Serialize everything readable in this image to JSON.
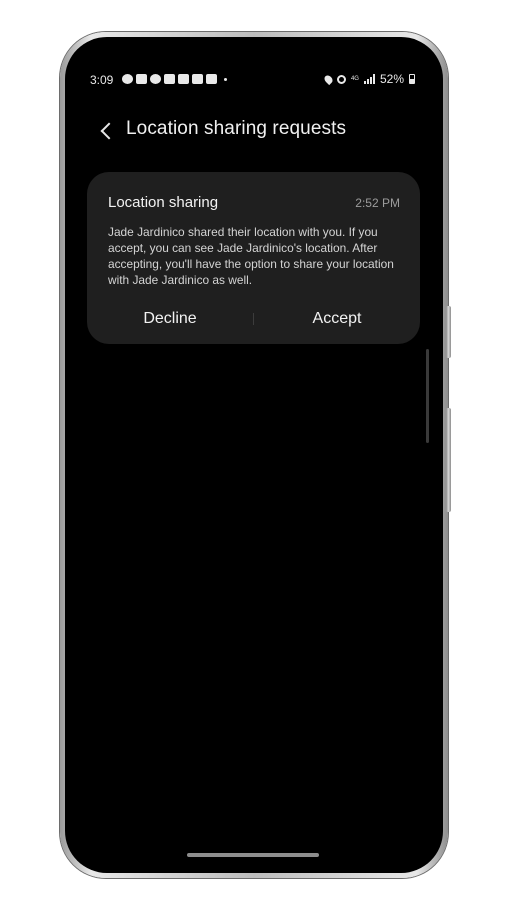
{
  "status_bar": {
    "time": "3:09",
    "battery": "52%",
    "network": "4G",
    "icons_left": [
      "minus-circle-icon",
      "screenshot-icon",
      "headset-icon",
      "gallery-icon",
      "image-icon",
      "youtube-icon",
      "youtube-icon",
      "dot-icon"
    ],
    "icons_right": [
      "location-icon",
      "hotspot-icon",
      "lte-icon",
      "signal-icon",
      "battery-icon"
    ]
  },
  "header": {
    "title": "Location sharing requests",
    "back_icon": "chevron-left-icon"
  },
  "notification": {
    "title": "Location sharing",
    "time": "2:52 PM",
    "body": "Jade Jardinico shared their location with you. If you accept, you can see Jade Jardinico's location. After accepting, you'll have the option to share your location with Jade Jardinico as well.",
    "decline_label": "Decline",
    "accept_label": "Accept"
  },
  "colors": {
    "background": "#000000",
    "card": "#1f1f1f",
    "text": "#f2f2f2",
    "secondary_text": "#9c9c9c"
  }
}
